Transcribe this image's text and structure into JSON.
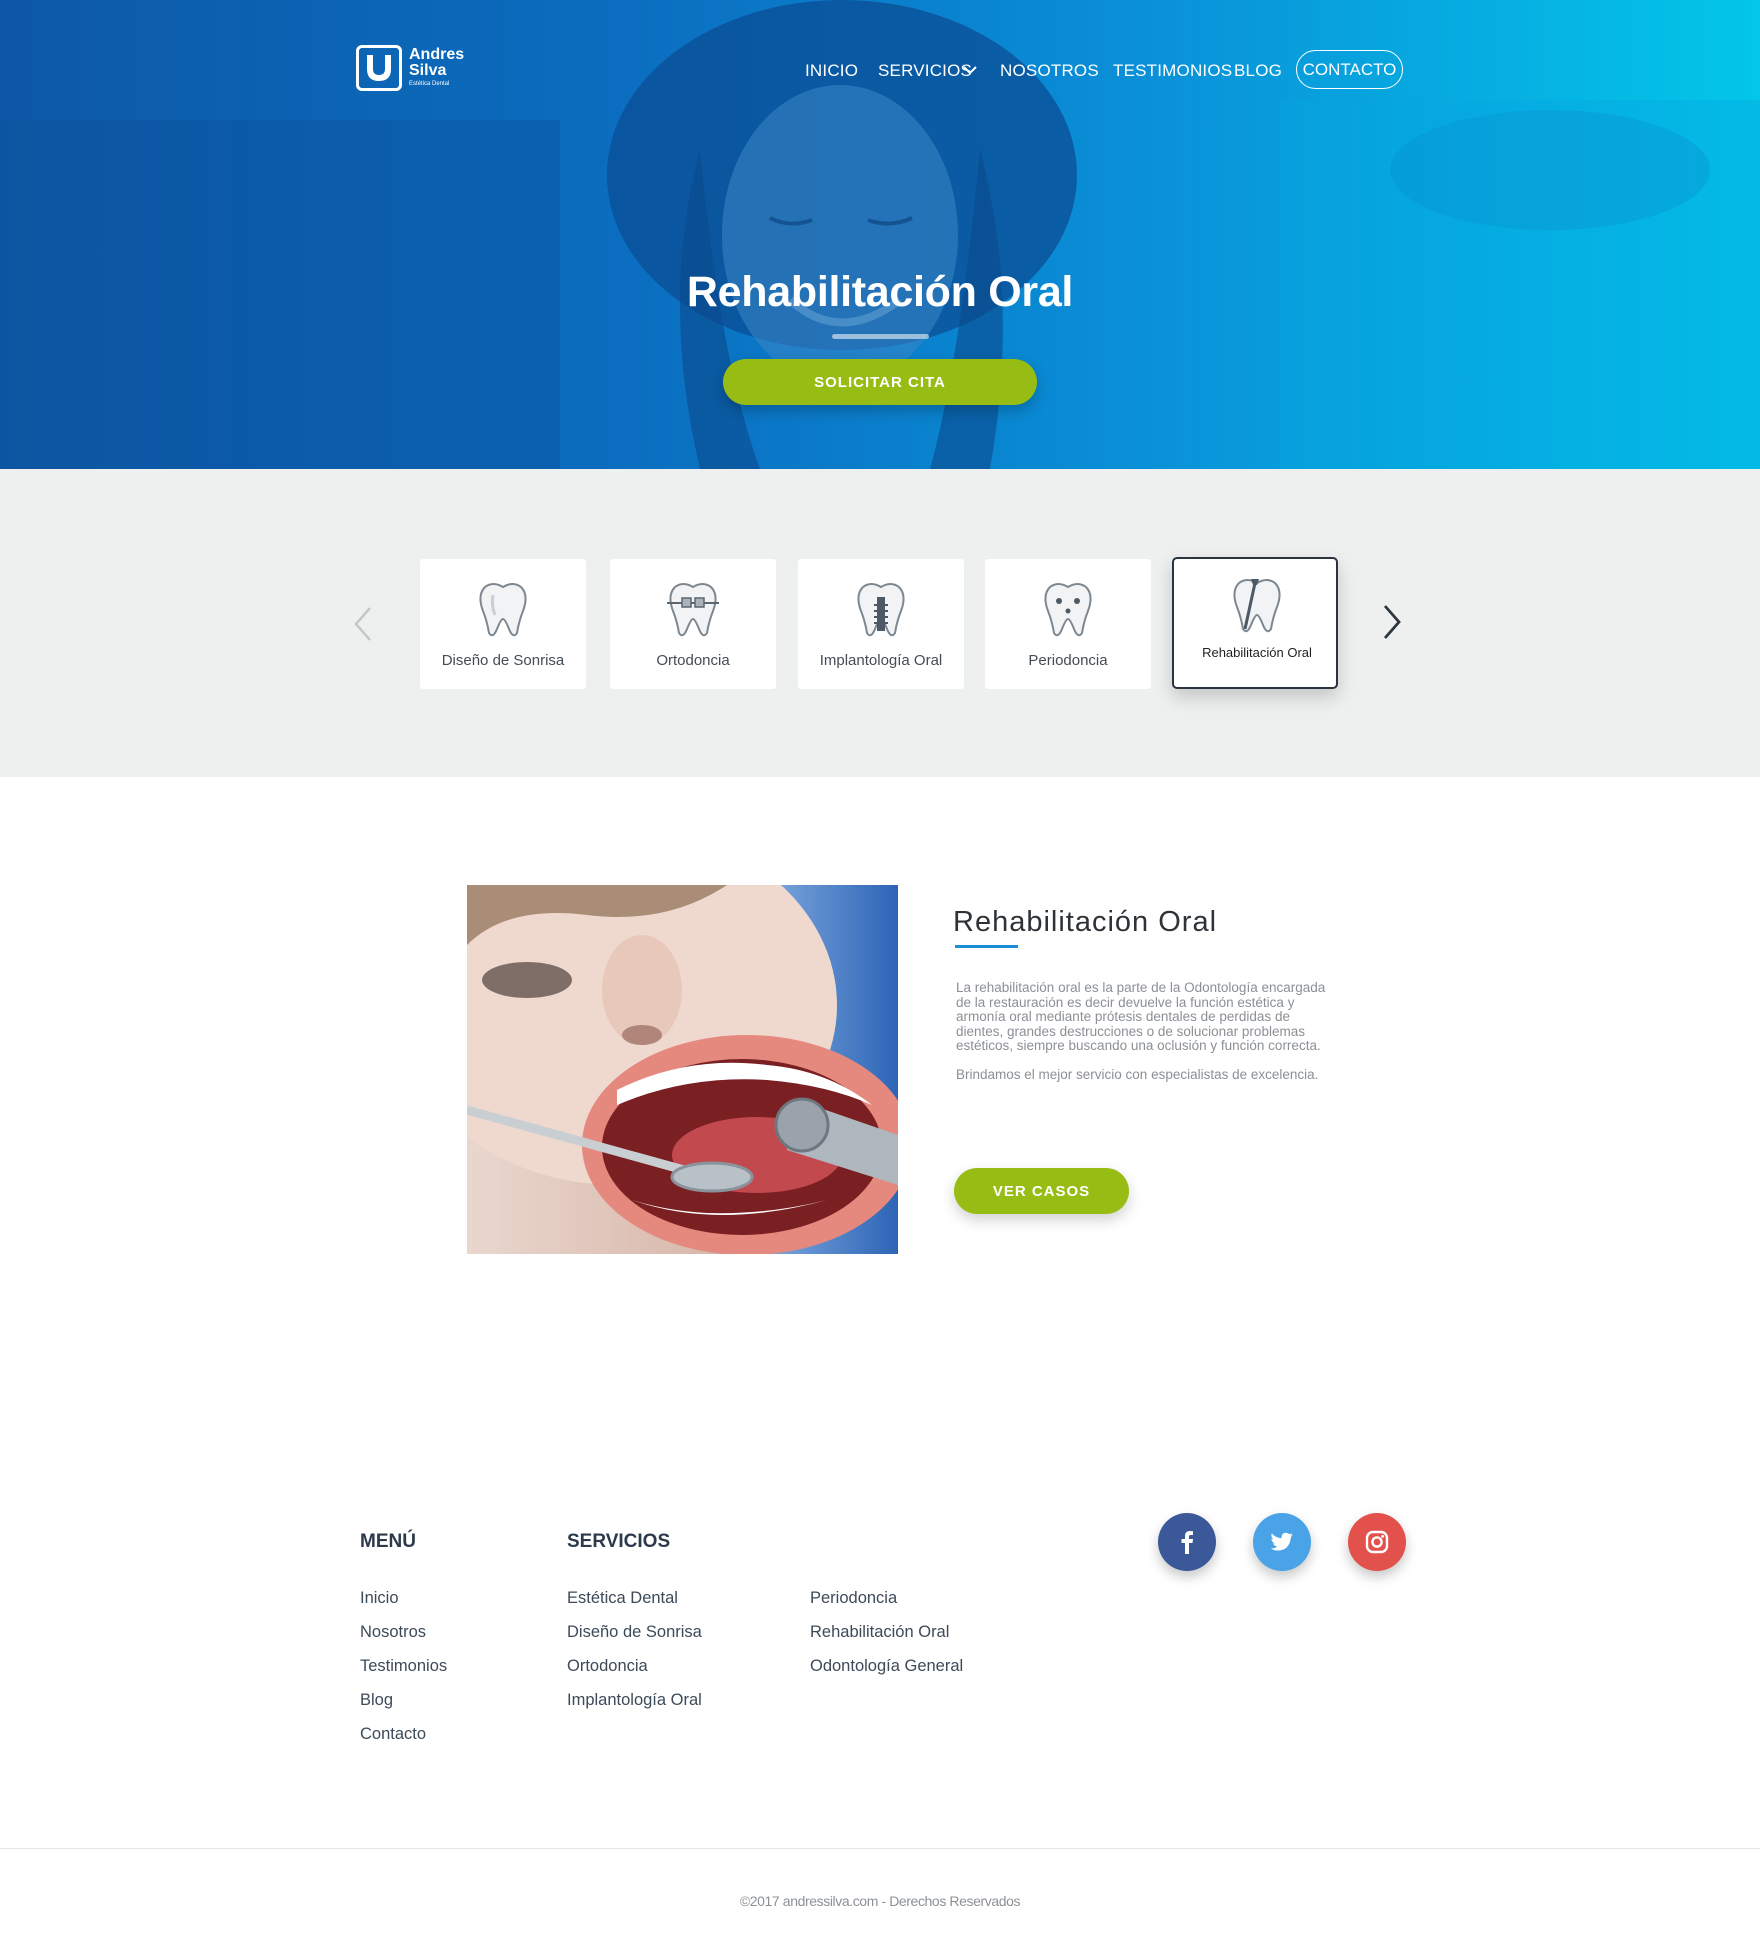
{
  "brand": {
    "name_line1": "Andres",
    "name_line2": "Silva",
    "tagline": "Estética Dental"
  },
  "nav": {
    "items": [
      "INICIO",
      "SERVICIOS",
      "NOSOTROS",
      "TESTIMONIOS",
      "BLOG"
    ],
    "dropdown_icon": "chevron-down-icon",
    "contact": "CONTACTO"
  },
  "hero": {
    "title": "Rehabilitación Oral",
    "cta": "SOLICITAR CITA"
  },
  "services": {
    "cards": [
      {
        "label": "Diseño de Sonrisa",
        "icon": "tooth-icon"
      },
      {
        "label": "Ortodoncia",
        "icon": "tooth-braces-icon"
      },
      {
        "label": "Implantología Oral",
        "icon": "tooth-implant-icon"
      },
      {
        "label": "Periodoncia",
        "icon": "tooth-gum-icon"
      },
      {
        "label": "Rehabilitación Oral",
        "icon": "tooth-restoration-icon"
      }
    ],
    "active_index": 4,
    "prev_icon": "chevron-left-icon",
    "next_icon": "chevron-right-icon"
  },
  "detail": {
    "title": "Rehabilitación Oral",
    "paragraph1": "La rehabilitación oral es la parte de la Odontología encargada de la restauración es decir devuelve la función estética y armonía oral mediante prótesis dentales de perdidas de dientes, grandes destrucciones o de solucionar problemas estéticos, siempre buscando una oclusión y función correcta.",
    "paragraph2": "Brindamos el mejor servicio con especialistas de excelencia.",
    "cta": "VER CASOS"
  },
  "footer": {
    "menu_heading": "MENÚ",
    "menu_items": [
      "Inicio",
      "Nosotros",
      "Testimonios",
      "Blog",
      "Contacto"
    ],
    "services_heading": "SERVICIOS",
    "services_col1": [
      "Estética Dental",
      "Diseño de Sonrisa",
      "Ortodoncia",
      "Implantología Oral"
    ],
    "services_col2": [
      "Periodoncia",
      "Rehabilitación Oral",
      "Odontología General"
    ],
    "social": [
      {
        "name": "facebook-icon",
        "color": "#3b5998"
      },
      {
        "name": "twitter-icon",
        "color": "#4aa3e6"
      },
      {
        "name": "instagram-icon",
        "color": "#e2514c"
      }
    ],
    "copyright": "©2017 andressilva.com - Derechos Reservados"
  },
  "colors": {
    "accent_green": "#97bd14",
    "hero_blue_start": "#0d58a6",
    "hero_blue_end": "#03c6e9",
    "underline_blue": "#1a8fd6"
  }
}
